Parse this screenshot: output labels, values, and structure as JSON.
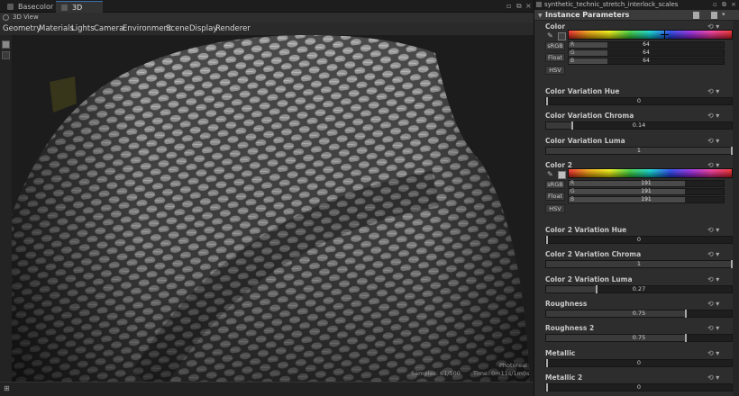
{
  "tabs": [
    {
      "label": "Basecolor",
      "active": false
    },
    {
      "label": "3D View",
      "active": true
    }
  ],
  "viewport_label": "3D View",
  "menu": [
    "Geometry",
    "Materials",
    "Lights",
    "Camera",
    "Environment",
    "Scene",
    "Display",
    "Renderer"
  ],
  "hud": {
    "engine": "Photoreal",
    "samples": "Samples: 61/500",
    "time": "Time: 0m11s/1m0s"
  },
  "panel": {
    "title": "synthetic_technic_stretch_interlock_scales",
    "section": "Instance Parameters",
    "color_modes": [
      "sRGB",
      "Float",
      "HSV"
    ],
    "color1": {
      "label": "Color",
      "swatch": "#404040",
      "channels": [
        {
          "name": "R",
          "value": "64"
        },
        {
          "name": "G",
          "value": "64"
        },
        {
          "name": "B",
          "value": "64"
        }
      ]
    },
    "params_a": [
      {
        "label": "Color Variation Hue",
        "value": "0",
        "fraction": 0.0
      },
      {
        "label": "Color Variation Chroma",
        "value": "0.14",
        "fraction": 0.14
      },
      {
        "label": "Color Variation Luma",
        "value": "1",
        "fraction": 1.0
      }
    ],
    "color2": {
      "label": "Color 2",
      "swatch": "#bfbfbf",
      "channels": [
        {
          "name": "R",
          "value": "191"
        },
        {
          "name": "G",
          "value": "191"
        },
        {
          "name": "B",
          "value": "191"
        }
      ]
    },
    "params_b": [
      {
        "label": "Color 2 Variation Hue",
        "value": "0",
        "fraction": 0.0
      },
      {
        "label": "Color 2 Variation Chroma",
        "value": "1",
        "fraction": 1.0
      },
      {
        "label": "Color 2 Variation Luma",
        "value": "0.27",
        "fraction": 0.27
      },
      {
        "label": "Roughness",
        "value": "0.75",
        "fraction": 0.75
      },
      {
        "label": "Roughness 2",
        "value": "0.75",
        "fraction": 0.75
      },
      {
        "label": "Metallic",
        "value": "0",
        "fraction": 0.0
      },
      {
        "label": "Metallic 2",
        "value": "0",
        "fraction": 0.0
      }
    ]
  }
}
